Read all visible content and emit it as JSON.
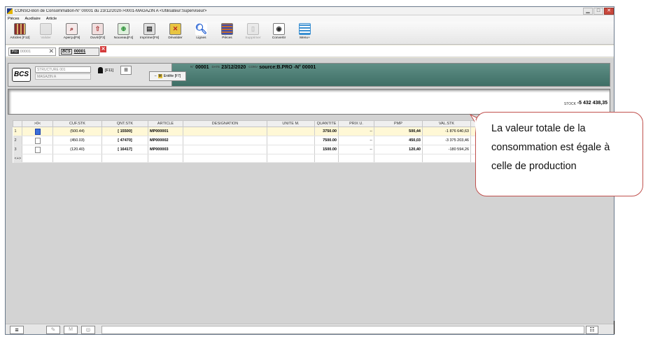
{
  "window": {
    "title": "CONSO-Bon de Consommation-N° 00001 du 23/12/2020->0001-MAGAZIN A <Utilisateur:Superviseur>",
    "minimize": "▁",
    "maximize": "□",
    "close": "✕"
  },
  "menu": [
    "Pièces",
    "Auxiliaire",
    "Article"
  ],
  "toolbar": [
    {
      "label": "Articles [F12]",
      "icon": "articles-icon",
      "enabled": true
    },
    {
      "label": "Valider",
      "icon": "validate-icon",
      "enabled": false
    },
    {
      "label": "Aperçu[F9]",
      "icon": "preview-icon",
      "enabled": true
    },
    {
      "label": "Ouvrir[F3]",
      "icon": "open-icon",
      "enabled": true
    },
    {
      "label": "Nouveau[F4]",
      "icon": "new-icon",
      "enabled": true
    },
    {
      "label": "Imprimer[F8]",
      "icon": "print-icon",
      "enabled": true
    },
    {
      "label": "Dévalider",
      "icon": "unvalidate-icon",
      "enabled": true
    },
    {
      "label": "Lignes",
      "icon": "lines-icon",
      "enabled": true
    },
    {
      "label": "Pièces",
      "icon": "documents-icon",
      "enabled": true
    },
    {
      "label": "Supprimer",
      "icon": "delete-icon",
      "enabled": false
    },
    {
      "label": "Convertir",
      "icon": "convert-icon",
      "enabled": true
    },
    {
      "label": "Menu+",
      "icon": "menu-icon",
      "enabled": true
    }
  ],
  "tabs": {
    "tab1_prefix": "Pro",
    "tab1_number": "00001",
    "tab1_close": "✕",
    "tab2_code": "BCS",
    "tab2_number": "00001",
    "tab2_close": "✕"
  },
  "header": {
    "logo": "BCS",
    "structure_label": "STRUCTURE",
    "structure_value": "001",
    "magazin": "MAGAZIN A",
    "user_button": "[F11]",
    "entete_prefix": "M",
    "entete_label": "Entête [F7]",
    "num_marker": "N°",
    "number": "00001",
    "date_label": "DATE",
    "date": "23/12/2020",
    "conv_label": "CONV",
    "source": "source:B.PRO -N° 00001"
  },
  "stock": {
    "label": "STOCK",
    "value": "-5 432 438,35"
  },
  "grid": {
    "columns": [
      ">0<",
      "CUF.STK",
      "QNT.STK",
      "ARTICLE",
      "DESIGNATION",
      "UNITE M.",
      "QUANTITE",
      "PRIX U.",
      "PMP",
      "VAL.STK"
    ],
    "rows": [
      {
        "num": "1",
        "cuf": "(500.44)",
        "qnt": "[ 15500]",
        "article": "MP000001",
        "designation": "",
        "unite": "",
        "quantite": "3750.00",
        "prix": "--",
        "pmp": "500,44",
        "val": "-1 876 640,63"
      },
      {
        "num": "2",
        "cuf": "(450.03)",
        "qnt": "[ 47470]",
        "article": "MP000002",
        "designation": "",
        "unite": "",
        "quantite": "7500.00",
        "prix": "--",
        "pmp": "450,03",
        "val": "-3 375 203,46"
      },
      {
        "num": "3",
        "cuf": "(120.40)",
        "qnt": "[ 16417]",
        "article": "MP000003",
        "designation": "",
        "unite": "",
        "quantite": "1500.00",
        "prix": "--",
        "pmp": "120,40",
        "val": "-180 594,26"
      }
    ],
    "new_row_marker": "<+>"
  },
  "callout": {
    "text": "La valeur totale de la consommation est égale à celle de production",
    "border_color": "#c0504d"
  }
}
